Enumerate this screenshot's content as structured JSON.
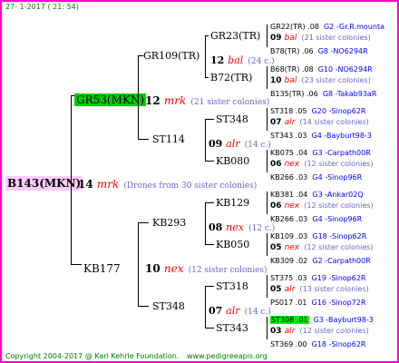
{
  "header": {
    "date": "27-  1-2017 ( 21: 54)"
  },
  "footer": {
    "copyright": "Copyright 2004-2017 @ Karl Kehrle Foundation.",
    "site": "www.pedigreeapis.org"
  },
  "root": {
    "name": "B143(MKN)",
    "gen": "14",
    "place": "mrk",
    "note": "(Drones from 30 sister colonies)"
  },
  "l1": [
    {
      "name": "GR53(MKN)",
      "gen": "12",
      "place": "mrk",
      "note": "(21 sister colonies)"
    },
    {
      "name": "KB177",
      "gen": "10",
      "place": "nex",
      "note": "(12 sister colonies)"
    }
  ],
  "l2": [
    {
      "name": "GR109(TR)",
      "gen": "12",
      "place": "bal",
      "note": "(24 c.)"
    },
    {
      "name": "ST114",
      "gen": "09",
      "place": "alr",
      "note": "(14 c.)"
    },
    {
      "name": "KB293",
      "gen": "08",
      "place": "nex",
      "note": "(12 c.)"
    },
    {
      "name": "ST348",
      "gen": "07",
      "place": "alr",
      "note": "(14 c.)"
    }
  ],
  "l3": [
    {
      "name": "GR23(TR)"
    },
    {
      "name": "B72(TR)"
    },
    {
      "name": "ST348"
    },
    {
      "name": "KB080"
    },
    {
      "name": "KB129"
    },
    {
      "name": "KB050"
    },
    {
      "name": "ST318"
    },
    {
      "name": "ST343"
    }
  ],
  "l4": [
    {
      "top": "GR22(TR) .08",
      "topc": "G2 -Gr.R.mounta",
      "gen": "09",
      "place": "bal",
      "note": "(21 sister colonies)",
      "bot": "B78(TR) .06",
      "botc": "G8 -NO6294R"
    },
    {
      "top": "B68(TR) .08",
      "topc": "G10 -NO6294R",
      "gen": "10",
      "place": "bal",
      "note": "(23 sister colonies)",
      "bot": "B135(TR) .06",
      "botc": "G8 -Takab93aR"
    },
    {
      "top": "ST318 .05",
      "topc": "G20 -Sinop62R",
      "gen": "07",
      "place": "alr",
      "note": "(14 sister colonies)",
      "bot": "ST343 .03",
      "botc": "G4 -Bayburt98-3"
    },
    {
      "top": "KB075 .04",
      "topc": "G3 -Carpath00R",
      "gen": "06",
      "place": "nex",
      "note": "(12 sister colonies)",
      "bot": "KB266 .03",
      "botc": "G4 -Sinop96R"
    },
    {
      "top": "KB381 .04",
      "topc": "G3 -Ankar02Q",
      "gen": "06",
      "place": "nex",
      "note": "(12 sister colonies)",
      "bot": "KB266 .03",
      "botc": "G4 -Sinop96R"
    },
    {
      "top": "KB109 .03",
      "topc": "G18 -Sinop62R",
      "gen": "05",
      "place": "nex",
      "note": "(12 sister colonies)",
      "bot": "KB309 .02",
      "botc": "G2 -Carpath00R"
    },
    {
      "top": "ST375 .03",
      "topc": "G19 -Sinop62R",
      "gen": "05",
      "place": "alr",
      "note": "(13 sister colonies)",
      "bot": "PS017 .01",
      "botc": "G16 -Sinop72R"
    },
    {
      "top": "ST308 .01",
      "topc": "G3 -Bayburt98-3",
      "gen": "03",
      "place": "alr",
      "note": "(12 sister colonies)",
      "bot": "ST369 .00",
      "botc": "G18 -Sinop62R"
    }
  ]
}
